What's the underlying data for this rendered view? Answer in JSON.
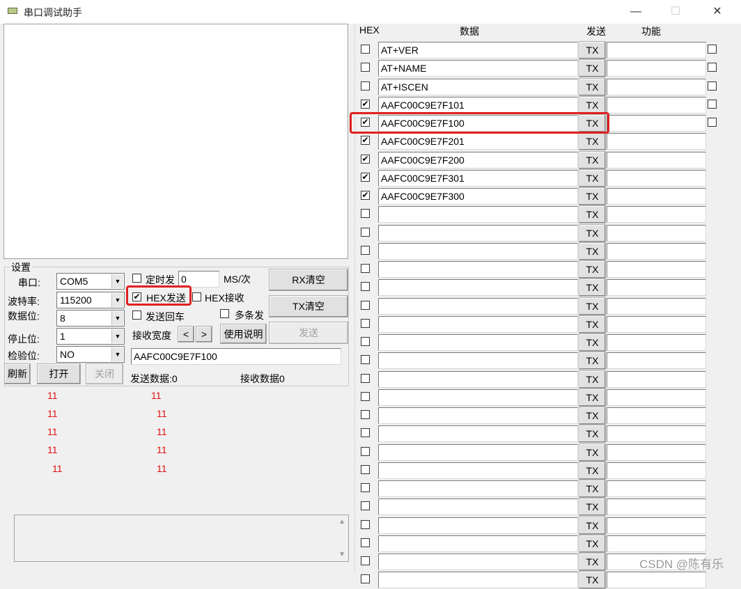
{
  "window": {
    "title": "串口调试助手",
    "controls": [
      "—",
      "☐",
      "✕"
    ]
  },
  "settings": {
    "group_label": "设置",
    "port_label": "串口:",
    "port_value": "COM5",
    "baud_label": "波特率:",
    "baud_value": "115200",
    "databits_label": "数据位:",
    "databits_value": "8",
    "stopbits_label": "停止位:",
    "stopbits_value": "1",
    "parity_label": "检验位:",
    "parity_value": "NO",
    "refresh_label": "刷新",
    "open_label": "打开",
    "close_label": "关闭"
  },
  "options": {
    "timed_send_label": "定时发",
    "timed_send_checked": false,
    "timed_interval": "0",
    "timed_unit": "MS/次",
    "hex_send_label": "HEX发送",
    "hex_send_checked": true,
    "hex_recv_label": "HEX接收",
    "hex_recv_checked": false,
    "send_newline_label": "发送回车",
    "send_newline_checked": false,
    "multi_send_label": "多条发",
    "multi_send_checked": false,
    "recv_width_label": "接收宽度",
    "width_less": "<",
    "width_more": ">",
    "help_label": "使用说明",
    "rx_clear_label": "RX清空",
    "tx_clear_label": "TX清空",
    "send_label": "发送",
    "send_input": "AAFC00C9E7F100",
    "sent_count_label": "发送数据:0",
    "recv_count_label": "接收数据0"
  },
  "red_numbers": {
    "col1": [
      "11",
      "11",
      "11",
      "11",
      "11"
    ],
    "col2": [
      "11",
      "11",
      "11",
      "11",
      "11"
    ]
  },
  "grid": {
    "header_hex": "HEX",
    "header_data": "数据",
    "header_send": "发送",
    "header_func": "功能",
    "tx_label": "TX",
    "rows": [
      {
        "hex": false,
        "data": "AT+VER",
        "func_check": true
      },
      {
        "hex": false,
        "data": "AT+NAME",
        "func_check": true
      },
      {
        "hex": false,
        "data": "AT+ISCEN",
        "func_check": true
      },
      {
        "hex": true,
        "data": "AAFC00C9E7F101",
        "func_check": true
      },
      {
        "hex": true,
        "data": "AAFC00C9E7F100",
        "func_check": true
      },
      {
        "hex": true,
        "data": "AAFC00C9E7F201",
        "func_check": false
      },
      {
        "hex": true,
        "data": "AAFC00C9E7F200",
        "func_check": false
      },
      {
        "hex": true,
        "data": "AAFC00C9E7F301",
        "func_check": false
      },
      {
        "hex": true,
        "data": "AAFC00C9E7F300",
        "func_check": false
      },
      {
        "hex": false,
        "data": "",
        "func_check": false
      },
      {
        "hex": false,
        "data": "",
        "func_check": false
      },
      {
        "hex": false,
        "data": "",
        "func_check": false
      },
      {
        "hex": false,
        "data": "",
        "func_check": false
      },
      {
        "hex": false,
        "data": "",
        "func_check": false
      },
      {
        "hex": false,
        "data": "",
        "func_check": false
      },
      {
        "hex": false,
        "data": "",
        "func_check": false
      },
      {
        "hex": false,
        "data": "",
        "func_check": false
      },
      {
        "hex": false,
        "data": "",
        "func_check": false
      },
      {
        "hex": false,
        "data": "",
        "func_check": false
      },
      {
        "hex": false,
        "data": "",
        "func_check": false
      },
      {
        "hex": false,
        "data": "",
        "func_check": false
      },
      {
        "hex": false,
        "data": "",
        "func_check": false
      },
      {
        "hex": false,
        "data": "",
        "func_check": false
      },
      {
        "hex": false,
        "data": "",
        "func_check": false
      },
      {
        "hex": false,
        "data": "",
        "func_check": false
      },
      {
        "hex": false,
        "data": "",
        "func_check": false
      },
      {
        "hex": false,
        "data": "",
        "func_check": false
      },
      {
        "hex": false,
        "data": "",
        "func_check": false
      },
      {
        "hex": false,
        "data": "",
        "func_check": false
      },
      {
        "hex": false,
        "data": "",
        "func_check": false
      }
    ]
  },
  "watermark": "CSDN @陈有乐"
}
